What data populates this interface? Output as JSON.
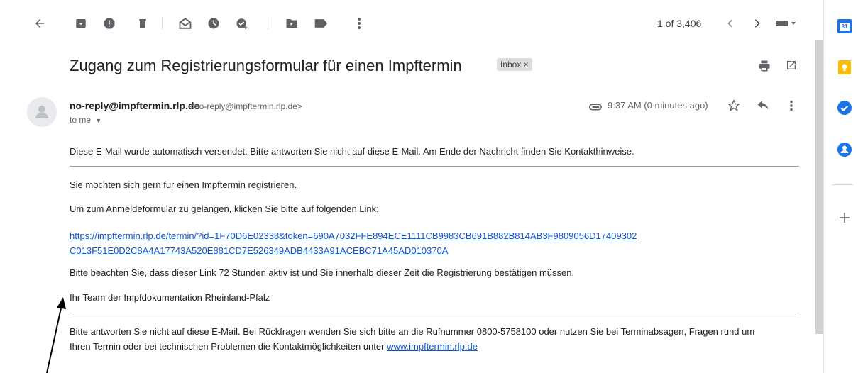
{
  "toolbar": {
    "icons": [
      "back-arrow-icon",
      "archive-icon",
      "report-spam-icon",
      "delete-icon",
      "mark-unread-icon",
      "snooze-icon",
      "add-task-icon",
      "move-to-icon",
      "label-icon",
      "more-vert-icon"
    ],
    "counter": "1 of 3,406"
  },
  "email": {
    "subject": "Zugang zum Registrierungsformular für einen Impftermin",
    "label_chip": "Inbox ×",
    "sender_name": "no-reply@impftermin.rlp.de",
    "sender_address": "<no-reply@impftermin.rlp.de>",
    "to": "to me",
    "time": "9:37 AM (0 minutes ago)",
    "intro": "Diese E-Mail wurde automatisch versendet. Bitte antworten Sie nicht auf diese E-Mail. Am Ende der Nachricht finden Sie Kontakthinweise.",
    "p1": "Sie möchten sich gern für einen Impftermin registrieren.",
    "p2": "Um zum Anmeldeformular zu gelangen, klicken Sie bitte auf folgenden Link:",
    "link_line1": "https://impftermin.rlp.de/termin/?id=1F70D6E02338&token=690A7032FFE894ECE1111CB9983CB691B882B814AB3F9809056D17409302",
    "link_line2": "C013F51E0D2C8A4A17743A520E881CD7E526349ADB4433A91ACEBC71A45AD010370A",
    "p3": "Bitte beachten Sie, dass dieser Link 72 Stunden aktiv ist und Sie innerhalb dieser Zeit die Registrierung bestätigen müssen.",
    "signature": "Ihr Team der Impfdokumentation Rheinland-Pfalz",
    "footer_line1": "Bitte antworten Sie nicht auf diese E-Mail. Bei Rückfragen wenden Sie sich bitte an die Rufnummer 0800-5758100 oder nutzen Sie bei Terminabsagen, Fragen rund um",
    "footer_line2_prefix": "Ihren Termin oder bei technischen Problemen die Kontaktmöglichkeiten unter ",
    "footer_link": "www.impftermin.rlp.de"
  },
  "side_panel": {
    "calendar_day": "31",
    "icons": [
      "calendar-icon",
      "keep-icon",
      "tasks-icon",
      "contacts-icon",
      "add-icon"
    ]
  },
  "colors": {
    "calendar_blue": "#1a73e8",
    "keep_yellow": "#fbbc04",
    "tasks_blue": "#1a73e8",
    "contacts_blue": "#1a73e8",
    "link_blue": "#1155cc"
  }
}
